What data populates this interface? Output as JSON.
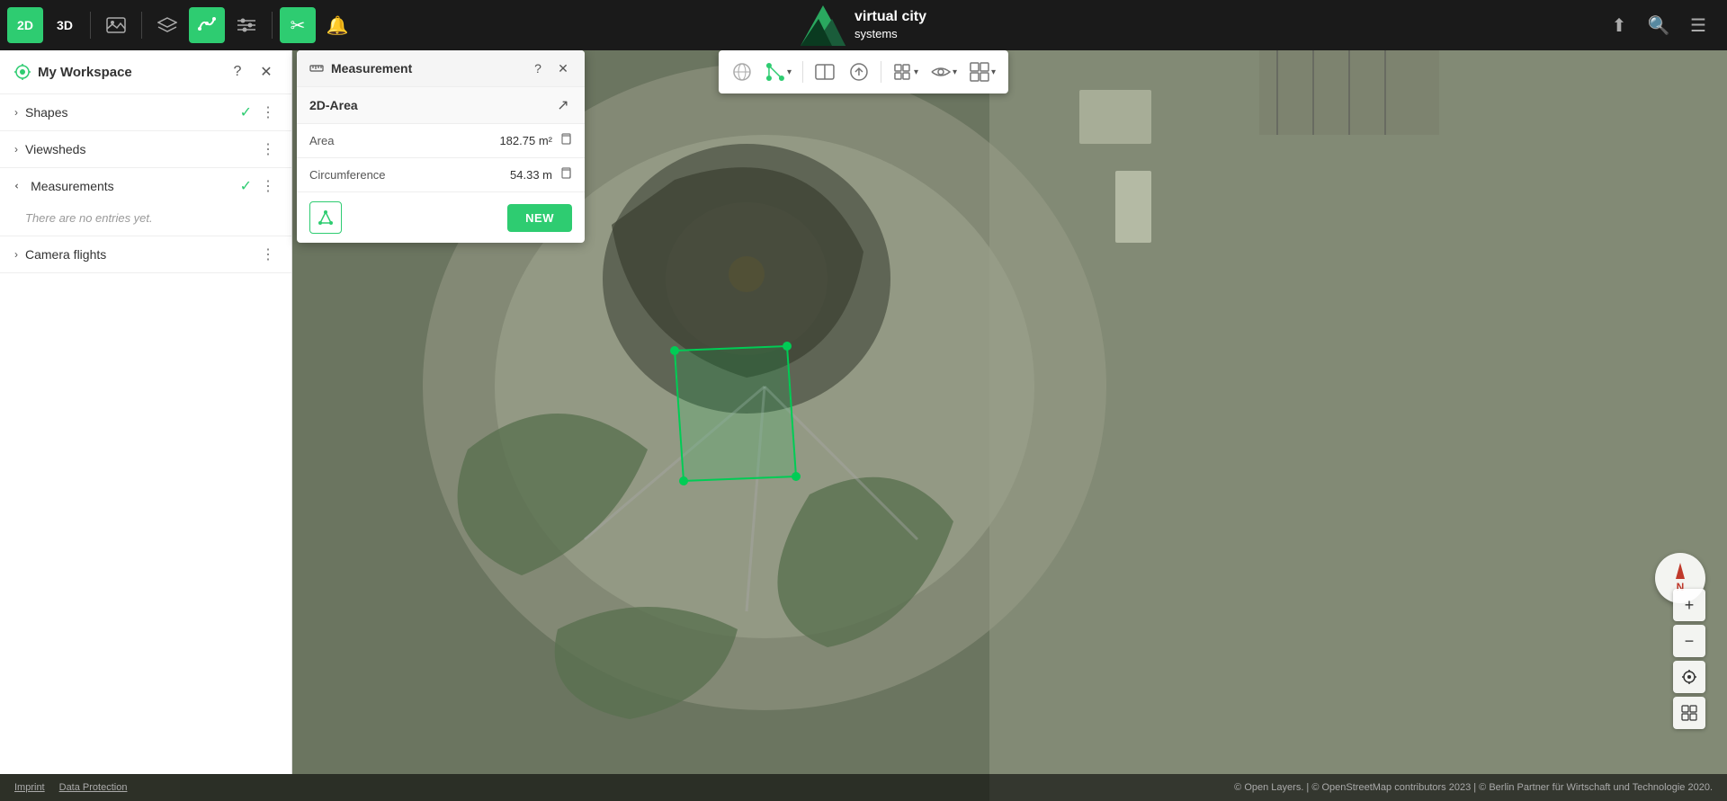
{
  "app": {
    "title": "virtual city systems"
  },
  "toolbar": {
    "btn_2d": "2D",
    "btn_3d": "3D",
    "view_label": "View"
  },
  "logo": {
    "line1": "virtual city",
    "line2": "systems"
  },
  "sidebar": {
    "title": "My Workspace",
    "sections": [
      {
        "id": "shapes",
        "label": "Shapes",
        "has_check": true,
        "expanded": false
      },
      {
        "id": "viewsheds",
        "label": "Viewsheds",
        "has_check": false,
        "expanded": false
      },
      {
        "id": "measurements",
        "label": "Measurements",
        "has_check": true,
        "expanded": true,
        "empty_text": "There are no entries yet."
      },
      {
        "id": "camera-flights",
        "label": "Camera flights",
        "has_check": false,
        "expanded": false
      }
    ]
  },
  "measurement_panel": {
    "title": "Measurement",
    "type_label": "2D-Area",
    "area_key": "Area",
    "area_value": "182.75 m²",
    "circumference_key": "Circumference",
    "circumference_value": "54.33 m",
    "new_btn": "NEW"
  },
  "status_bar": {
    "imprint": "Imprint",
    "data_protection": "Data Protection",
    "attribution": "© Open Layers. | © OpenStreetMap contributors 2023 | © Berlin Partner für Wirtschaft und Technologie 2020."
  },
  "icons": {
    "help": "?",
    "close": "✕",
    "three_dot": "⋮",
    "chevron_right": "›",
    "chevron_down": "⌄",
    "copy": "⧉",
    "ruler": "📐",
    "share": "⬆",
    "search": "🔍",
    "menu": "☰",
    "plus": "+",
    "minus": "−",
    "location": "◎",
    "map_view": "⊞",
    "layers": "≡",
    "settings": "⚙"
  }
}
